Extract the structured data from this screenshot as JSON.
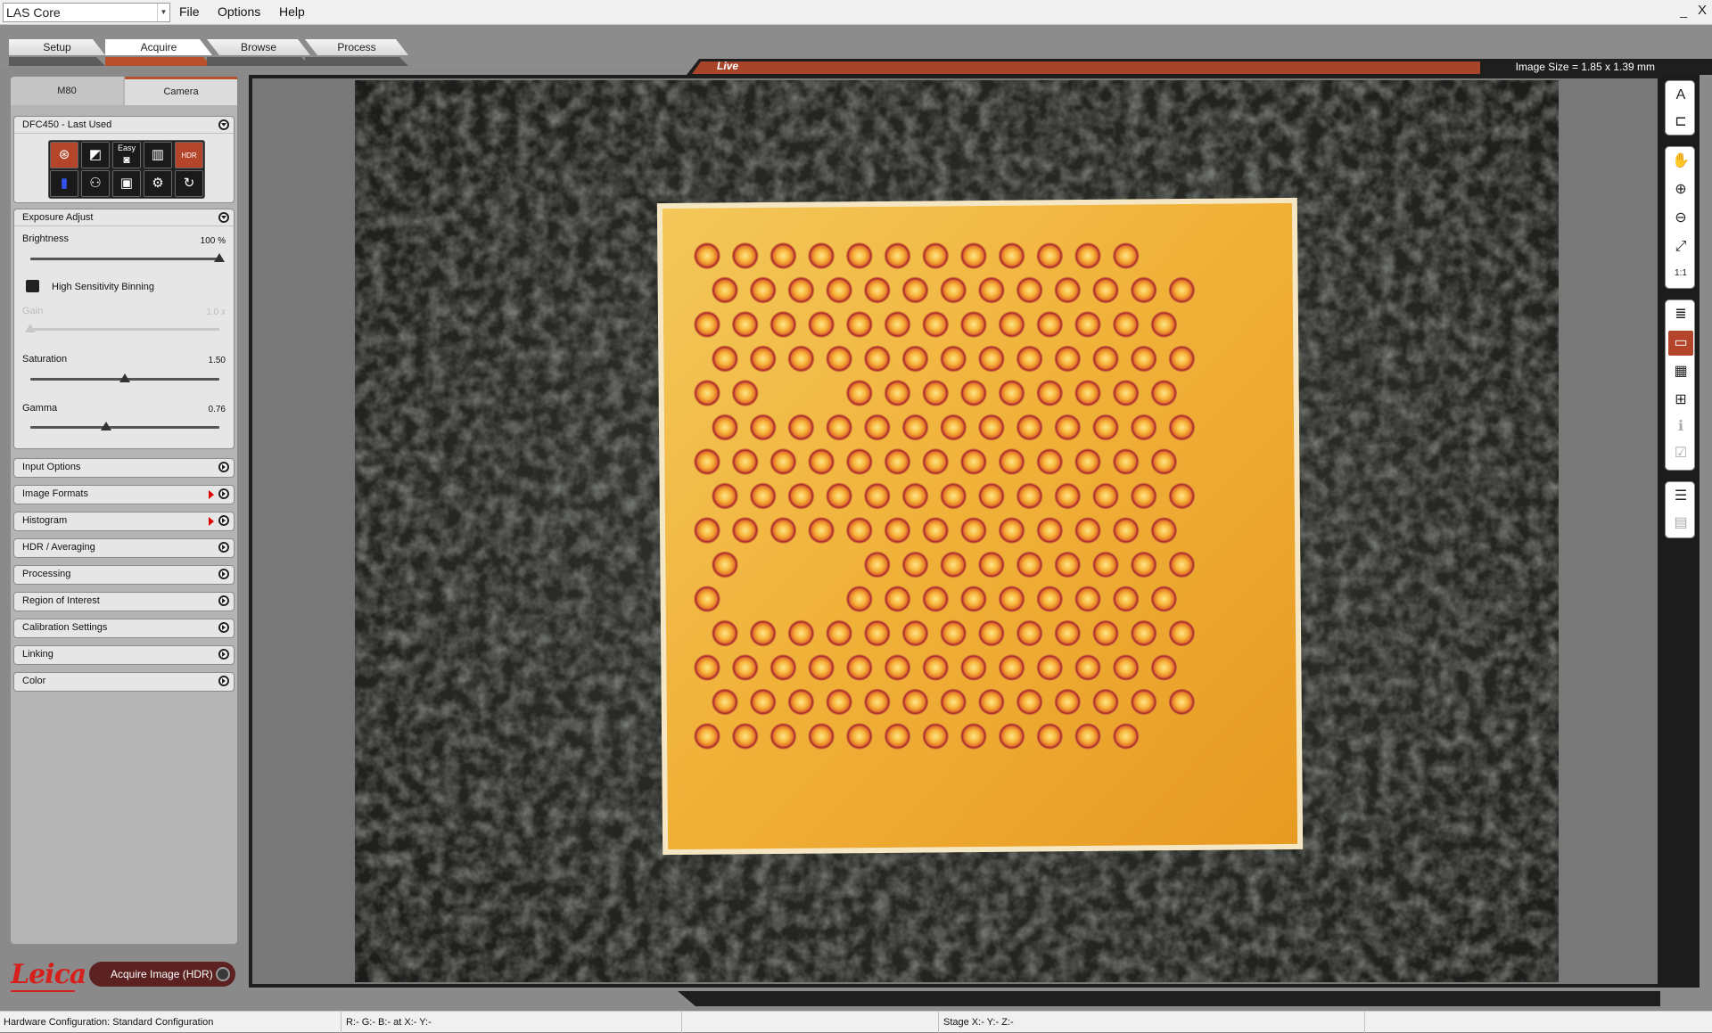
{
  "window": {
    "app_selector": "LAS Core",
    "menu": [
      "File",
      "Options",
      "Help"
    ],
    "minimize_glyph": "_",
    "close_glyph": "X"
  },
  "workflow_tabs": [
    {
      "label": "Setup",
      "active": false
    },
    {
      "label": "Acquire",
      "active": true
    },
    {
      "label": "Browse",
      "active": false
    },
    {
      "label": "Process",
      "active": false
    }
  ],
  "panel_tabs": {
    "m80": "M80",
    "camera": "Camera"
  },
  "camera_section": {
    "title": "DFC450 - Last Used",
    "icons": [
      {
        "name": "aperture-icon",
        "glyph": "⊛"
      },
      {
        "name": "exposure-icon",
        "glyph": "◩"
      },
      {
        "name": "easy-camera-icon",
        "glyph": "Easy"
      },
      {
        "name": "camera-settings-icon",
        "glyph": "▥"
      },
      {
        "name": "hdr-icon",
        "glyph": "HDR"
      },
      {
        "name": "color-balance-icon",
        "glyph": "▮"
      },
      {
        "name": "color-channels-icon",
        "glyph": "⚇"
      },
      {
        "name": "frame-icon",
        "glyph": "▣"
      },
      {
        "name": "adjust-icon",
        "glyph": "⚙"
      },
      {
        "name": "refresh-icon",
        "glyph": "↻"
      }
    ]
  },
  "exposure_adjust": {
    "title": "Exposure Adjust",
    "brightness": {
      "label": "Brightness",
      "value": "100 %",
      "level": 1.0
    },
    "binning": {
      "label": "High Sensitivity Binning",
      "checked": true
    },
    "gain": {
      "label": "Gain",
      "value": "1.0 x",
      "level": 0.0,
      "disabled": true
    },
    "saturation": {
      "label": "Saturation",
      "value": "1.50",
      "level": 0.5
    },
    "gamma": {
      "label": "Gamma",
      "value": "0.76",
      "level": 0.4
    }
  },
  "collapsed_sections": [
    {
      "label": "Input Options",
      "flag": false
    },
    {
      "label": "Image Formats",
      "flag": true
    },
    {
      "label": "Histogram",
      "flag": true
    },
    {
      "label": "HDR / Averaging",
      "flag": false
    },
    {
      "label": "Processing",
      "flag": false
    },
    {
      "label": "Region of Interest",
      "flag": false
    },
    {
      "label": "Calibration Settings",
      "flag": false
    },
    {
      "label": "Linking",
      "flag": false
    },
    {
      "label": "Color",
      "flag": false
    }
  ],
  "brand": {
    "logo": "Leica",
    "color": "#d6201c"
  },
  "acquire_button": "Acquire Image (HDR)",
  "viewer": {
    "mode": "Live",
    "image_size": "Image Size = 1.85 x 1.39 mm",
    "accent": "#a8442a"
  },
  "right_toolbar": [
    {
      "name": "annotate-icon",
      "glyph": "A"
    },
    {
      "name": "tree-icon",
      "glyph": "⊏"
    },
    {
      "name": "pan-hand-icon",
      "glyph": "✋"
    },
    {
      "name": "zoom-in-icon",
      "glyph": "⊕"
    },
    {
      "name": "zoom-out-icon",
      "glyph": "⊖"
    },
    {
      "name": "fit-to-window-icon",
      "glyph": "⤢"
    },
    {
      "name": "actual-size-icon",
      "glyph": "1:1"
    },
    {
      "name": "document-view-icon",
      "glyph": "≣"
    },
    {
      "name": "single-view-icon",
      "glyph": "▭"
    },
    {
      "name": "table-view-icon",
      "glyph": "▦"
    },
    {
      "name": "grid-view-icon",
      "glyph": "⊞"
    },
    {
      "name": "info-icon",
      "glyph": "ℹ"
    },
    {
      "name": "checklist-icon",
      "glyph": "☑"
    },
    {
      "name": "list-collapse-icon",
      "glyph": "☰"
    },
    {
      "name": "save-icon",
      "glyph": "▤"
    }
  ],
  "status_bar": {
    "hardware": "Hardware Configuration: Standard Configuration",
    "pixel": "R:-  G:-  B:-  at X:-  Y:-",
    "stage": "Stage X:-  Y:-  Z:-"
  }
}
